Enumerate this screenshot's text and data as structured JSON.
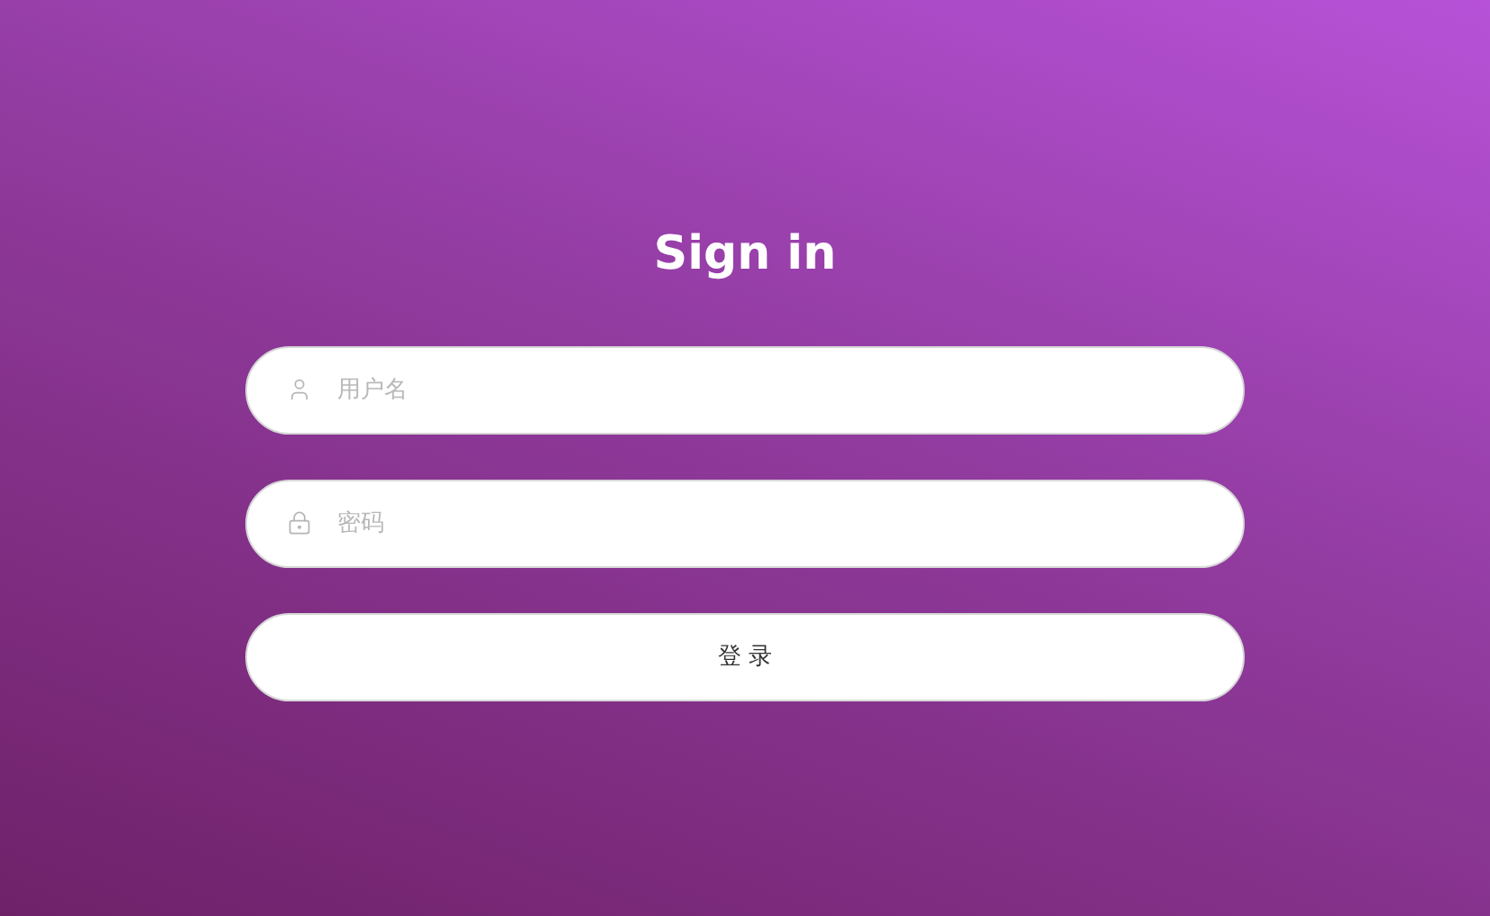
{
  "title": "Sign in",
  "fields": [
    {
      "kind": "username",
      "placeholder": "用户名"
    },
    {
      "kind": "password",
      "placeholder": "密码"
    }
  ],
  "submit": {
    "label": "登 录"
  }
}
